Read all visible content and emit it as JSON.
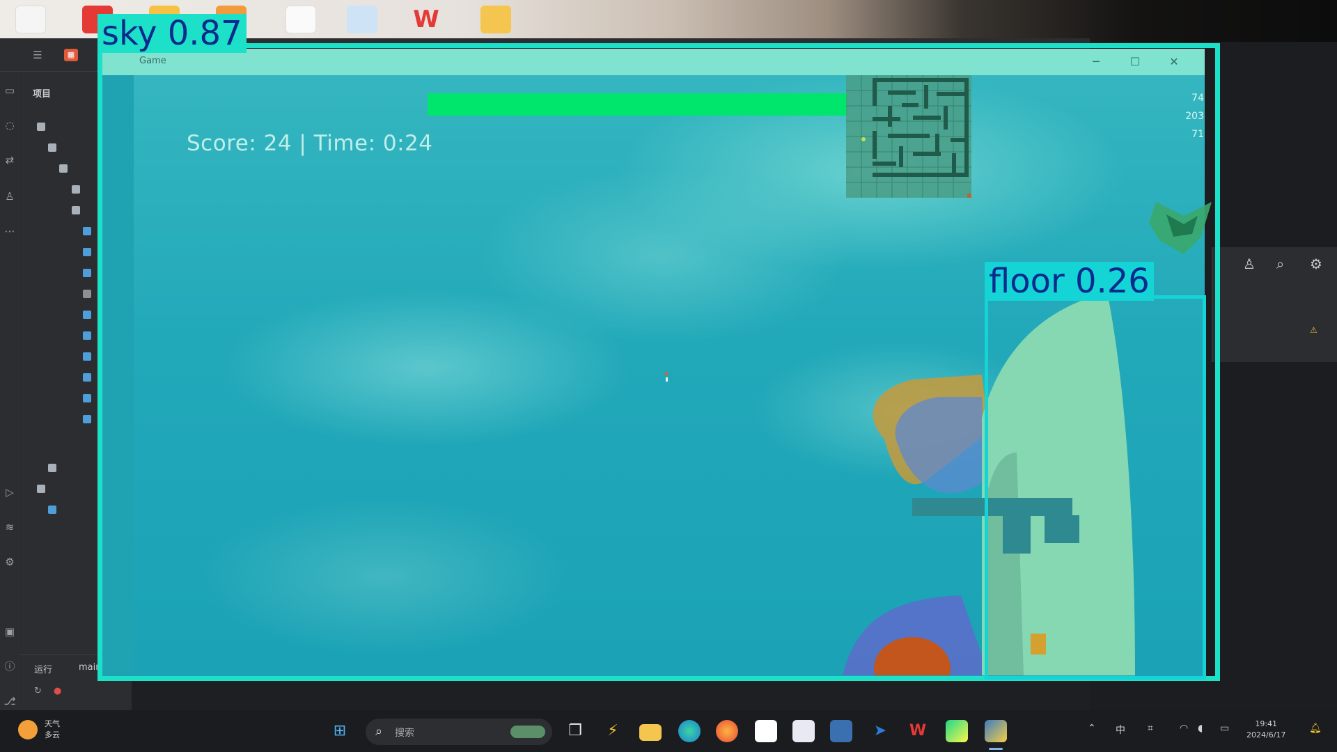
{
  "game": {
    "window_title": "Game",
    "hud_text": "Score: 24 | Time: 0:24",
    "side_marks": [
      "74",
      "203",
      "71"
    ],
    "minimize": "─",
    "maximize": "☐",
    "close": "✕"
  },
  "detections": [
    {
      "label": "sky 0.87"
    },
    {
      "label": "floor 0.26"
    }
  ],
  "ide": {
    "run_tab_1": "运行",
    "run_tab_2": "main",
    "project_label": "项目"
  },
  "taskbar": {
    "weather_line1": "天气",
    "weather_line2": "多云",
    "search_placeholder": "搜索",
    "tray_lang": "中",
    "clock_time": "19:41",
    "clock_date": "2024/6/17"
  },
  "colors": {
    "health": "#00e56b",
    "detection_sky": "#1de0c8",
    "detection_floor": "#15d4d6",
    "label_text": "#0a2a8c"
  }
}
